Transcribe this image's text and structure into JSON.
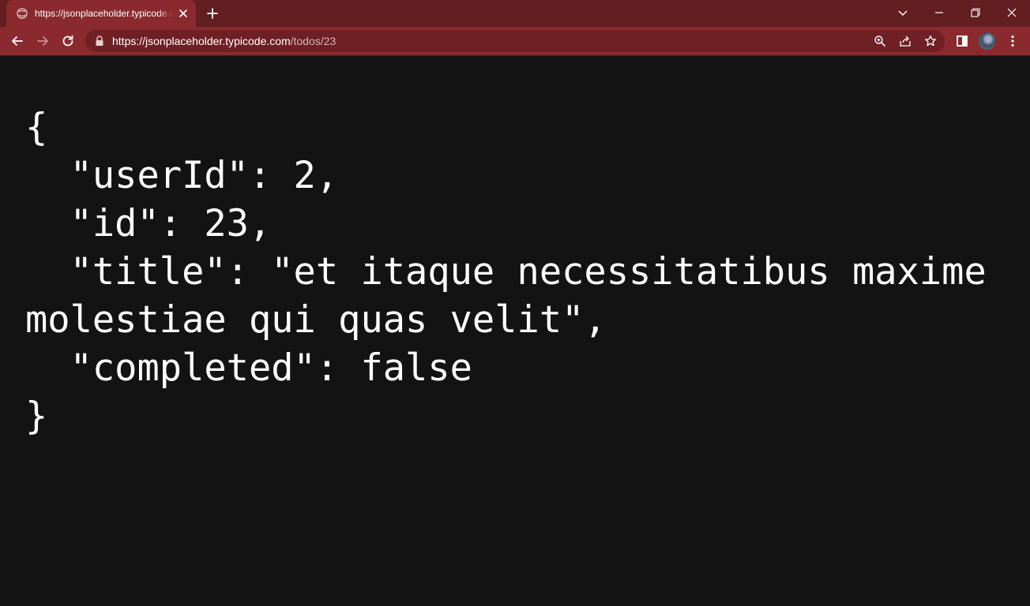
{
  "browser": {
    "tab": {
      "title": "https://jsonplaceholder.typicode.com/todos/23",
      "favicon": "globe-icon"
    },
    "address_bar": {
      "url_host": "https://jsonplaceholder.typicode.com",
      "url_path": "/todos/23"
    },
    "toolbar_icons": [
      "back-icon",
      "forward-icon",
      "reload-icon",
      "lock-icon",
      "zoom-icon",
      "share-icon",
      "bookmark-star-icon",
      "side-panel-icon",
      "profile-avatar",
      "menu-icon"
    ],
    "window_controls": [
      "tab-search-icon",
      "minimize-icon",
      "restore-icon",
      "close-icon"
    ],
    "colors": {
      "frame": "#621e21",
      "toolbar": "#8a2a2e",
      "omnibox": "#6f2024",
      "content_bg": "#131313",
      "text": "#ffffff"
    }
  },
  "content": {
    "json_text": "{\n  \"userId\": 2,\n  \"id\": 23,\n  \"title\": \"et itaque necessitatibus maxime molestiae qui quas velit\",\n  \"completed\": false\n}"
  }
}
